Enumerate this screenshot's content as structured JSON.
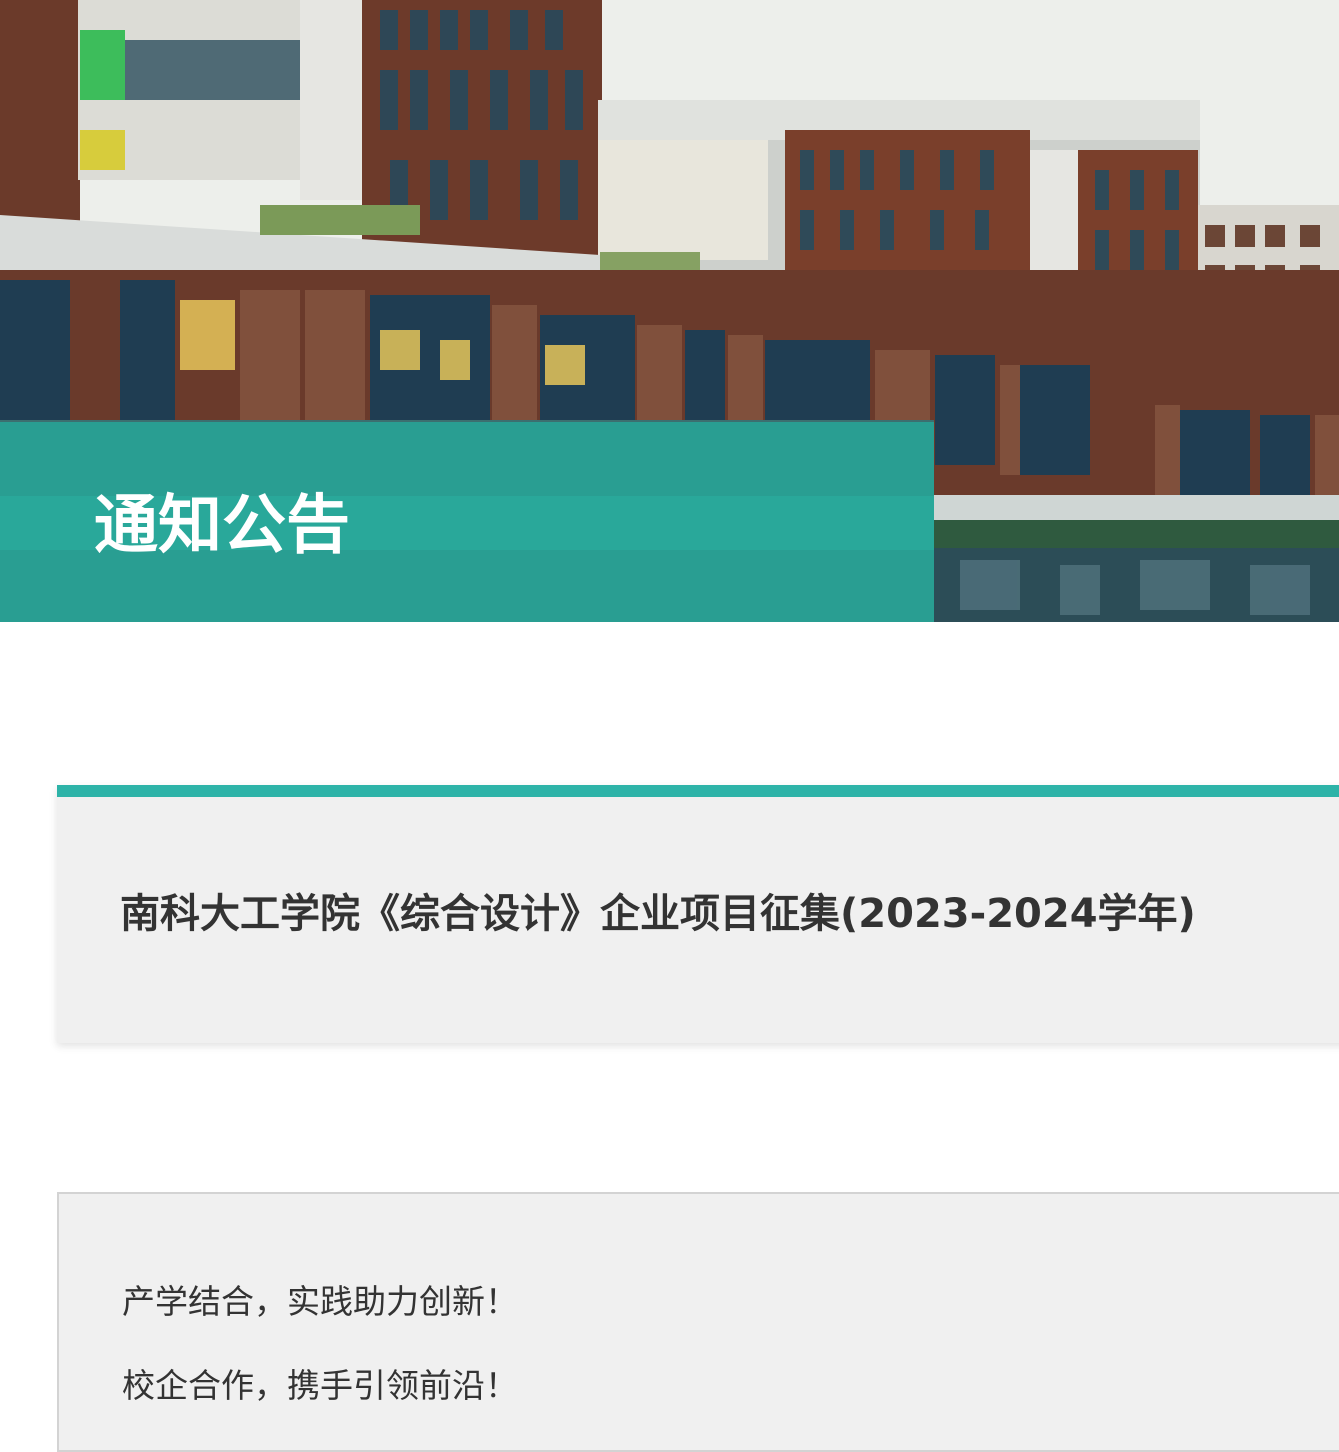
{
  "banner": {
    "title": "通知公告",
    "accent_color": "#27a596"
  },
  "article": {
    "title": "南科大工学院《综合设计》企业项目征集(2023-2024学年)",
    "accent_color": "#2db3a8",
    "paragraphs": [
      "产学结合，实践助力创新！",
      "校企合作，携手引领前沿！"
    ]
  }
}
